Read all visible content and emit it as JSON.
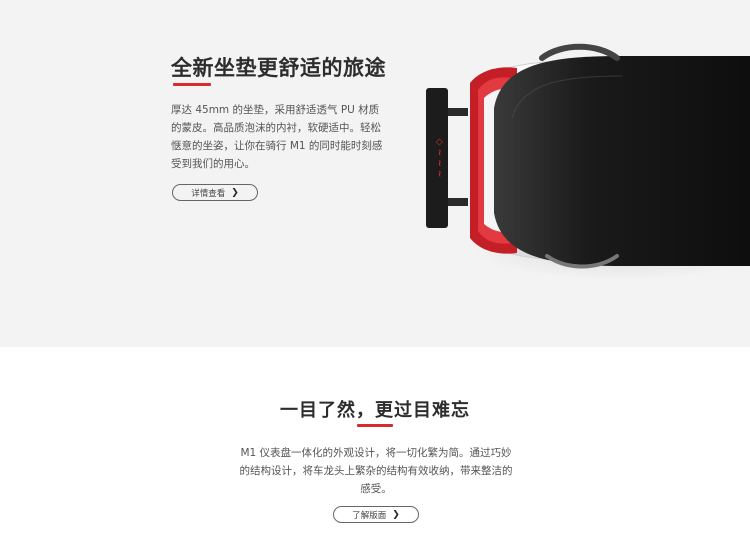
{
  "hero": {
    "title": "全新坐垫更舒适的旅途",
    "description": "厚达 45mm 的坐垫，采用舒适透气 PU 材质的蒙皮。高品质泡沫的内衬，软硬适中。轻松惬意的坐姿，让你在骑行 M1 的同时能时刻感受到我们的用心。",
    "button_label": "详情查看",
    "accent_color": "#d8292f"
  },
  "section2": {
    "title": "一目了然，更过目难忘",
    "description": "M1 仪表盘一体化的外观设计，将一切化繁为简。通过巧妙的结构设计，将车龙头上繁杂的结构有效收纳，带来整洁的感受。",
    "button_label": "了解版面"
  },
  "icons": {
    "button_chevron": "chevron-right-icon"
  }
}
